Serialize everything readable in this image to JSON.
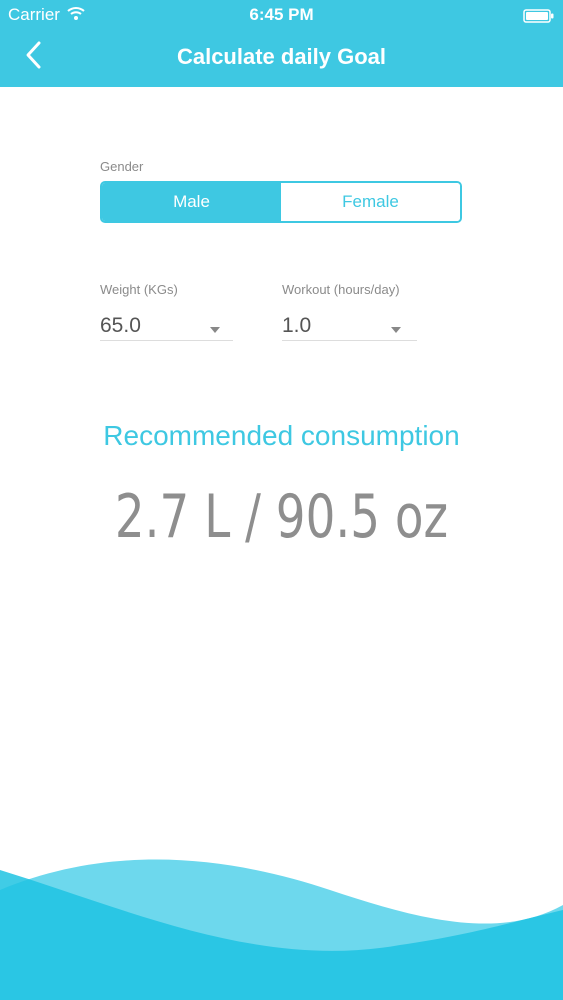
{
  "status_bar": {
    "carrier": "Carrier",
    "time": "6:45 PM"
  },
  "header": {
    "title": "Calculate daily Goal"
  },
  "form": {
    "gender_label": "Gender",
    "gender_options": [
      "Male",
      "Female"
    ],
    "gender_selected": "Male",
    "weight_label": "Weight (KGs)",
    "weight_value": "65.0",
    "workout_label": "Workout (hours/day)",
    "workout_value": "1.0"
  },
  "result": {
    "title": "Recommended consumption",
    "value": "2.7 L / 90.5 oz"
  },
  "colors": {
    "accent": "#3ec8e2",
    "wave_dark": "#1fc3e2",
    "wave_light": "#5fd4ea"
  }
}
